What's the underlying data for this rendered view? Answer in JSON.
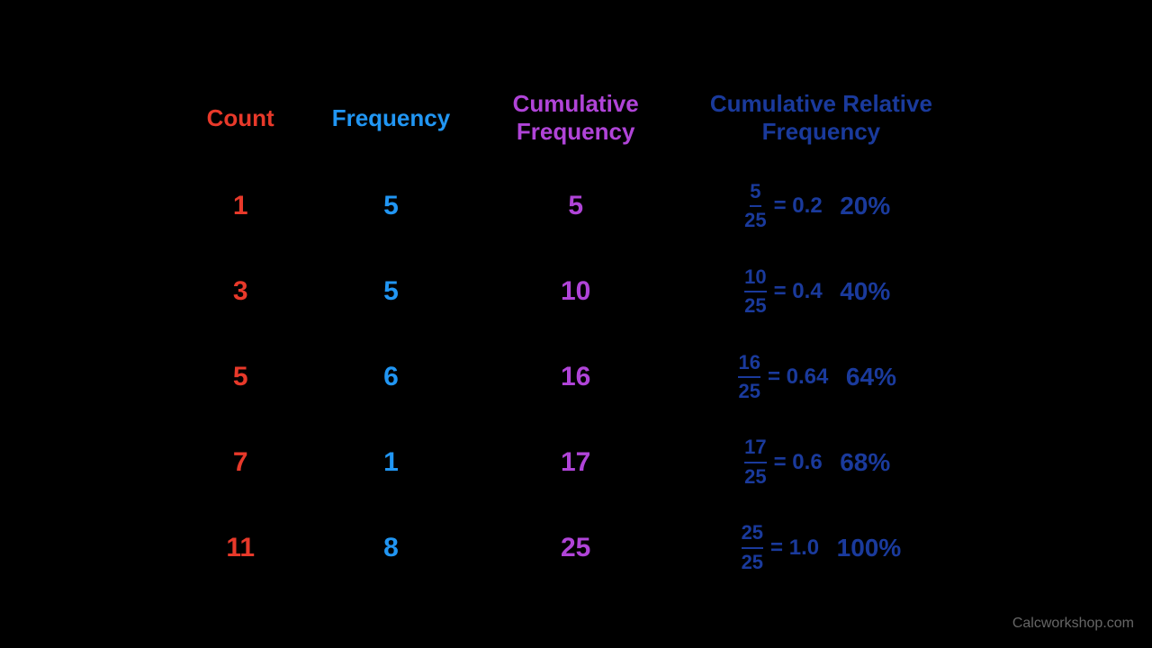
{
  "headers": {
    "count": "Count",
    "frequency": "Frequency",
    "cumulative_frequency": "Cumulative Frequency",
    "cumulative_relative_frequency_line1": "Cumulative Relative",
    "cumulative_relative_frequency_line2": "Frequency"
  },
  "rows": [
    {
      "count": "1",
      "frequency": "5",
      "cumfreq": "5",
      "fraction_num": "5",
      "fraction_den": "25",
      "decimal": "= 0.2",
      "percent": "20%"
    },
    {
      "count": "3",
      "frequency": "5",
      "cumfreq": "10",
      "fraction_num": "10",
      "fraction_den": "25",
      "decimal": "= 0.4",
      "percent": "40%"
    },
    {
      "count": "5",
      "frequency": "6",
      "cumfreq": "16",
      "fraction_num": "16",
      "fraction_den": "25",
      "decimal": "= 0.64",
      "percent": "64%"
    },
    {
      "count": "7",
      "frequency": "1",
      "cumfreq": "17",
      "fraction_num": "17",
      "fraction_den": "25",
      "decimal": "= 0.6",
      "percent": "68%"
    },
    {
      "count": "11",
      "frequency": "8",
      "cumfreq": "25",
      "fraction_num": "25",
      "fraction_den": "25",
      "decimal": "= 1.0",
      "percent": "100%"
    }
  ],
  "watermark": "Calcworkshop.com"
}
